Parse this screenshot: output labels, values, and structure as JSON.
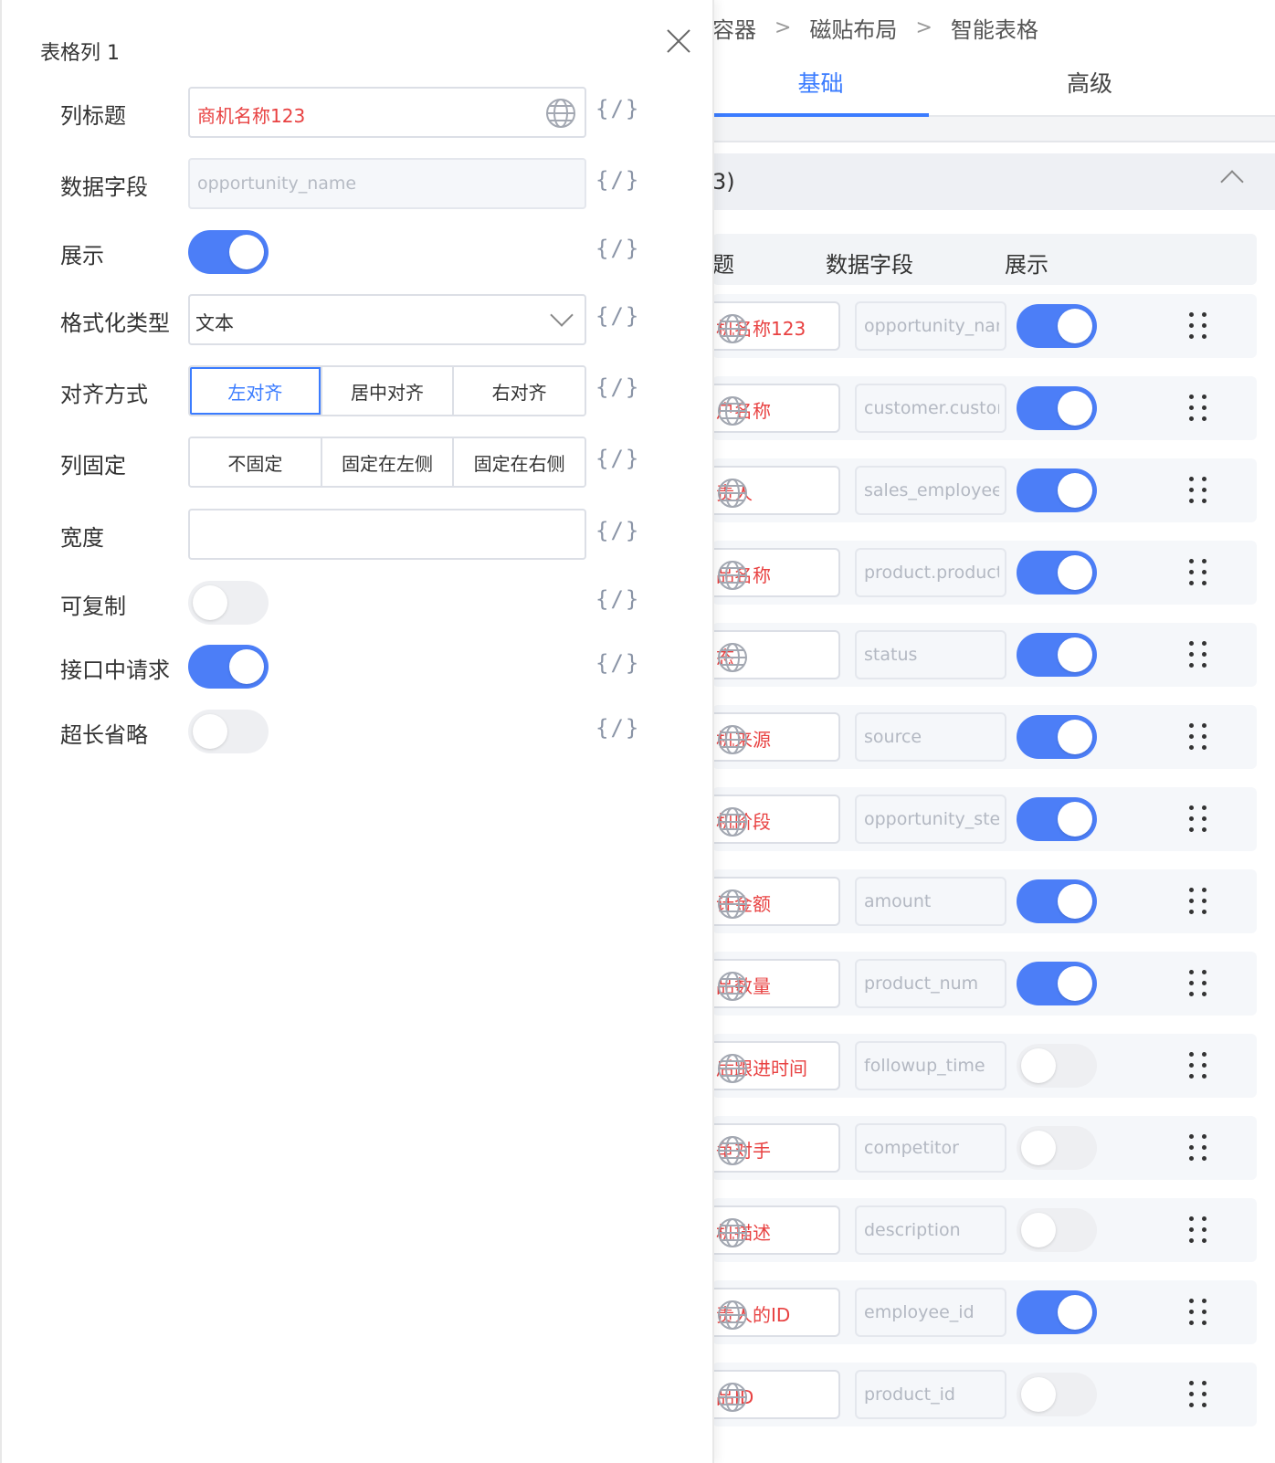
{
  "breadcrumb": [
    "容器",
    "磁贴布局",
    "智能表格"
  ],
  "tabs": {
    "basic": "基础",
    "advanced": "高级"
  },
  "group_header_label": "3)",
  "table_headers": {
    "title": "题",
    "field": "数据字段",
    "show": "展示"
  },
  "rows": [
    {
      "title": "机名称123",
      "field": "opportunity_name",
      "on": true
    },
    {
      "title": "户名称",
      "field": "customer.customer_name",
      "on": true
    },
    {
      "title": "责人",
      "field": "sales_employee.employee_name",
      "on": true
    },
    {
      "title": "品名称",
      "field": "product.product_name",
      "on": true
    },
    {
      "title": "态",
      "field": "status",
      "on": true
    },
    {
      "title": "机来源",
      "field": "source",
      "on": true
    },
    {
      "title": "机阶段",
      "field": "opportunity_step",
      "on": true
    },
    {
      "title": "计金额",
      "field": "amount",
      "on": true
    },
    {
      "title": "品数量",
      "field": "product_num",
      "on": true
    },
    {
      "title": "后跟进时间",
      "field": "followup_time",
      "on": false
    },
    {
      "title": "争对手",
      "field": "competitor",
      "on": false
    },
    {
      "title": "机描述",
      "field": "description",
      "on": false
    },
    {
      "title": "责人的ID",
      "field": "employee_id",
      "on": true
    },
    {
      "title": "品ID",
      "field": "product_id",
      "on": false
    }
  ],
  "drawer": {
    "title": "表格列 1",
    "expr_icon": "{/}",
    "fields": {
      "column_title": {
        "label": "列标题",
        "value": "商机名称123"
      },
      "data_field": {
        "label": "数据字段",
        "placeholder": "opportunity_name"
      },
      "show": {
        "label": "展示",
        "on": true
      },
      "format_type": {
        "label": "格式化类型",
        "value": "文本"
      },
      "align": {
        "label": "对齐方式",
        "options": [
          "左对齐",
          "居中对齐",
          "右对齐"
        ],
        "selected": "左对齐"
      },
      "fixed": {
        "label": "列固定",
        "options": [
          "不固定",
          "固定在左侧",
          "固定在右侧"
        ],
        "selected": ""
      },
      "width": {
        "label": "宽度",
        "value": ""
      },
      "copyable": {
        "label": "可复制",
        "on": false
      },
      "api_request": {
        "label": "接口中请求",
        "on": true
      },
      "ellipsis": {
        "label": "超长省略",
        "on": false
      }
    }
  },
  "colors": {
    "accent": "#3b7cff",
    "toggle_on": "#4c7ef7",
    "title_red": "#e84141"
  }
}
